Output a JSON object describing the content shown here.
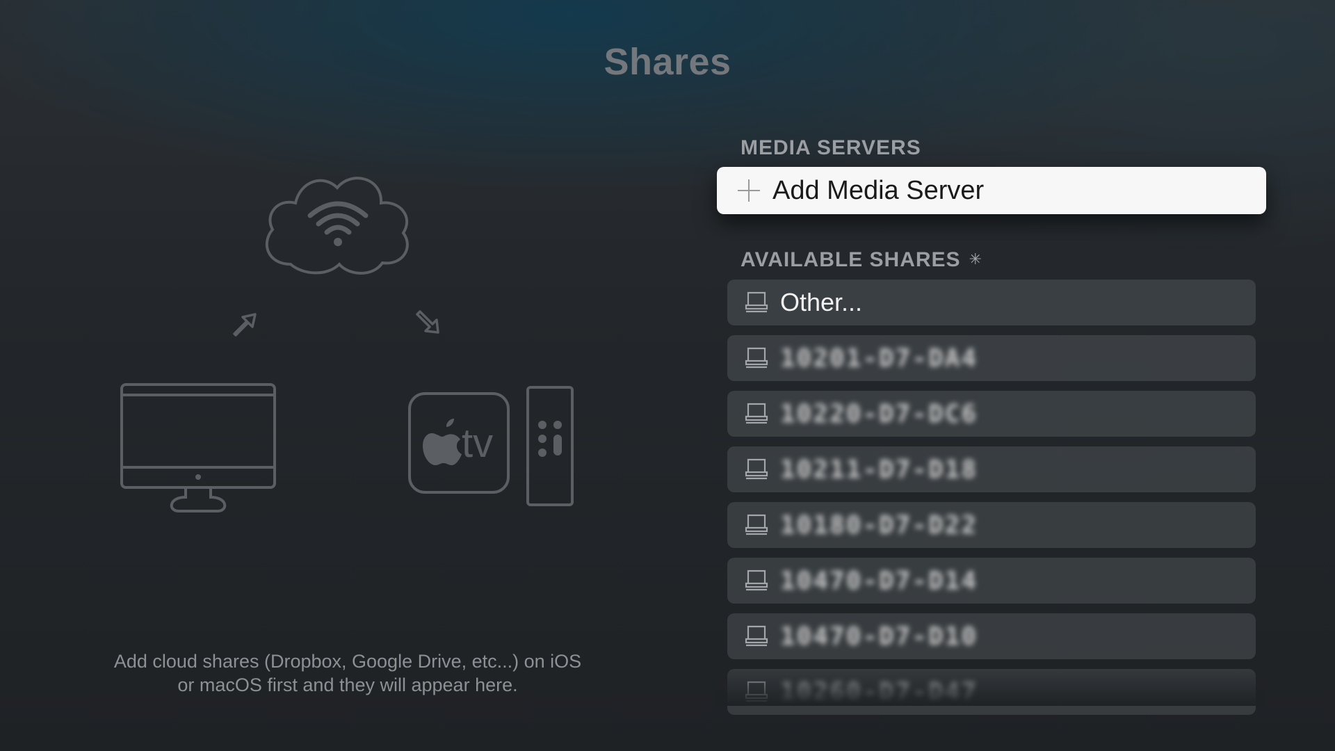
{
  "page": {
    "title": "Shares"
  },
  "illustration": {
    "info_text": "Add cloud shares (Dropbox, Google Drive, etc...) on iOS or macOS first and they will appear here.",
    "tv_label": "tv"
  },
  "media_servers": {
    "header": "MEDIA SERVERS",
    "add_button_label": "Add Media Server"
  },
  "available_shares": {
    "header": "AVAILABLE SHARES",
    "items": [
      {
        "label": "Other..."
      },
      {
        "label": "10201-D7-DA4"
      },
      {
        "label": "10220-D7-DC6"
      },
      {
        "label": "10211-D7-D18"
      },
      {
        "label": "10180-D7-D22"
      },
      {
        "label": "10470-D7-D14"
      },
      {
        "label": "10470-D7-D10"
      },
      {
        "label": "10260-D7-D47"
      }
    ]
  },
  "colors": {
    "title": "#74777b",
    "section_header": "#9b9ea2",
    "focused_bg": "#f7f7f7",
    "row_bg": "rgba(120,124,130,0.28)",
    "illustration_stroke": "#5b5e62"
  }
}
